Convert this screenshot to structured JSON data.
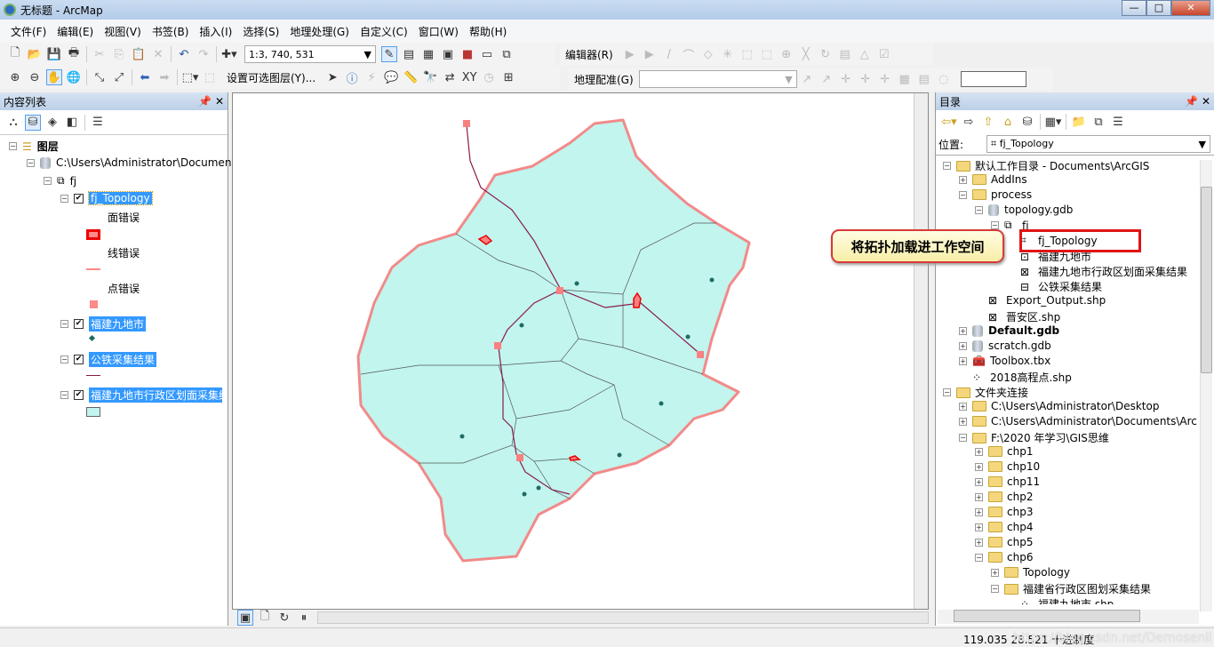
{
  "window": {
    "title": "无标题 - ArcMap",
    "min": "—",
    "max": "□",
    "close": "✕"
  },
  "menu": [
    "文件(F)",
    "编辑(E)",
    "视图(V)",
    "书签(B)",
    "插入(I)",
    "选择(S)",
    "地理处理(G)",
    "自定义(C)",
    "窗口(W)",
    "帮助(H)"
  ],
  "toolbar": {
    "scale": "1:3, 740, 531",
    "editor": "编辑器(R)",
    "select_layers": "设置可选图层(Y)...",
    "georef": "地理配准(G)"
  },
  "toc": {
    "title": "内容列表",
    "root": "图层",
    "path": "C:\\Users\\Administrator\\Documen",
    "dataset": "fj",
    "layers": [
      {
        "name": "fj_Topology",
        "checked": true,
        "legend": [
          {
            "label": "面错误"
          },
          {
            "label": "线错误"
          },
          {
            "label": "点错误"
          }
        ]
      },
      {
        "name": "福建九地市",
        "checked": true
      },
      {
        "name": "公铁采集结果",
        "checked": true
      },
      {
        "name": "福建九地市行政区划面采集结果",
        "checked": true
      }
    ]
  },
  "catalog": {
    "title": "目录",
    "location_label": "位置:",
    "location": "fj_Topology",
    "items": [
      {
        "label": "默认工作目录 - Documents\\ArcGIS",
        "level": 0,
        "exp": "−",
        "icon": "home-folder"
      },
      {
        "label": "AddIns",
        "level": 1,
        "exp": "+",
        "icon": "folder"
      },
      {
        "label": "process",
        "level": 1,
        "exp": "−",
        "icon": "folder"
      },
      {
        "label": "topology.gdb",
        "level": 2,
        "exp": "−",
        "icon": "gdb"
      },
      {
        "label": "fj",
        "level": 3,
        "exp": "−",
        "icon": "dataset"
      },
      {
        "label": "fj_Topology",
        "level": 4,
        "exp": "",
        "icon": "topology"
      },
      {
        "label": "福建九地市",
        "level": 4,
        "exp": "",
        "icon": "point-fc"
      },
      {
        "label": "福建九地市行政区划面采集结果",
        "level": 4,
        "exp": "",
        "icon": "polygon-fc"
      },
      {
        "label": "公铁采集结果",
        "level": 4,
        "exp": "",
        "icon": "line-fc"
      },
      {
        "label": "Export_Output.shp",
        "level": 2,
        "exp": "",
        "icon": "polygon-shp"
      },
      {
        "label": "晋安区.shp",
        "level": 2,
        "exp": "",
        "icon": "polygon-shp"
      },
      {
        "label": "Default.gdb",
        "level": 1,
        "exp": "+",
        "icon": "gdb",
        "bold": true
      },
      {
        "label": "scratch.gdb",
        "level": 1,
        "exp": "+",
        "icon": "gdb"
      },
      {
        "label": "Toolbox.tbx",
        "level": 1,
        "exp": "+",
        "icon": "toolbox"
      },
      {
        "label": "2018高程点.shp",
        "level": 1,
        "exp": "",
        "icon": "point-shp"
      },
      {
        "label": "文件夹连接",
        "level": 0,
        "exp": "−",
        "icon": "folder-conn"
      },
      {
        "label": "C:\\Users\\Administrator\\Desktop",
        "level": 1,
        "exp": "+",
        "icon": "folder-conn"
      },
      {
        "label": "C:\\Users\\Administrator\\Documents\\Arc",
        "level": 1,
        "exp": "+",
        "icon": "folder-conn"
      },
      {
        "label": "F:\\2020 年学习\\GIS思维",
        "level": 1,
        "exp": "−",
        "icon": "folder-conn"
      },
      {
        "label": "chp1",
        "level": 2,
        "exp": "+",
        "icon": "folder"
      },
      {
        "label": "chp10",
        "level": 2,
        "exp": "+",
        "icon": "folder"
      },
      {
        "label": "chp11",
        "level": 2,
        "exp": "+",
        "icon": "folder"
      },
      {
        "label": "chp2",
        "level": 2,
        "exp": "+",
        "icon": "folder"
      },
      {
        "label": "chp3",
        "level": 2,
        "exp": "+",
        "icon": "folder"
      },
      {
        "label": "chp4",
        "level": 2,
        "exp": "+",
        "icon": "folder"
      },
      {
        "label": "chp5",
        "level": 2,
        "exp": "+",
        "icon": "folder"
      },
      {
        "label": "chp6",
        "level": 2,
        "exp": "−",
        "icon": "folder"
      },
      {
        "label": "Topology",
        "level": 3,
        "exp": "+",
        "icon": "folder"
      },
      {
        "label": "福建省行政区图划采集结果",
        "level": 3,
        "exp": "−",
        "icon": "folder"
      },
      {
        "label": "福建九地市.shp",
        "level": 4,
        "exp": "",
        "icon": "point-shp"
      }
    ]
  },
  "callout": "将拓扑加载进工作空间",
  "status": {
    "coords": "119.035  28.521 十进制度",
    "watermark": "https://blog.csdn.net/Demosenli"
  },
  "colors": {
    "polygon_fill": "#c1f5ee",
    "error": "#f88080",
    "rail": "#8b1a4a",
    "city": "#1f6b63",
    "selection": "#3399ff"
  }
}
